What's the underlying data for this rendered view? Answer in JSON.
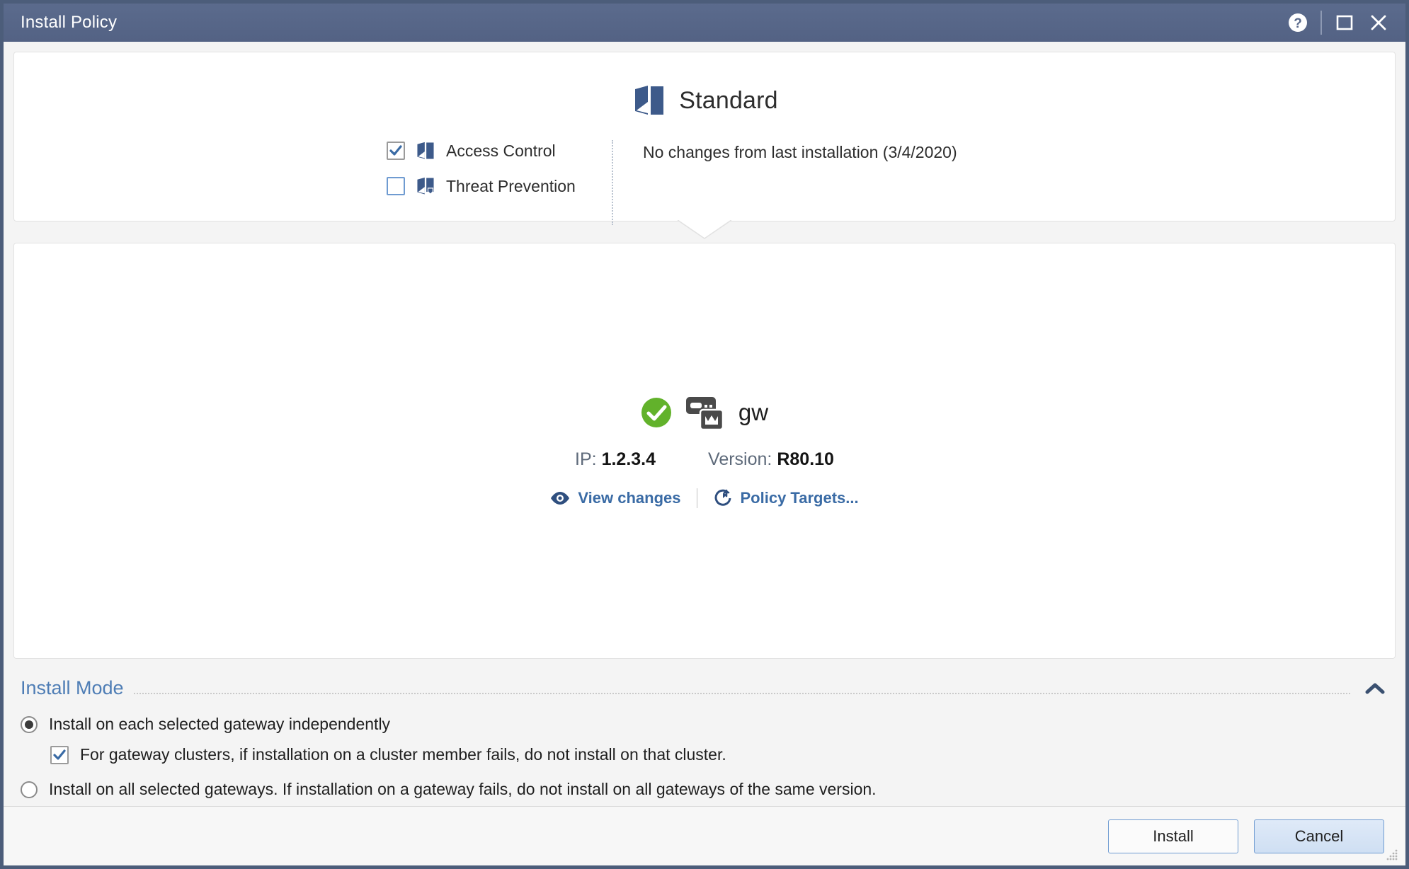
{
  "window": {
    "title": "Install Policy",
    "buttons": {
      "help": "help-icon",
      "maximize": "maximize-icon",
      "close": "close-icon"
    }
  },
  "policy": {
    "icon": "policy-package-icon",
    "name": "Standard",
    "blades": [
      {
        "label": "Access Control",
        "checked": true,
        "icon": "access-control-icon"
      },
      {
        "label": "Threat Prevention",
        "checked": false,
        "icon": "threat-prevention-icon"
      }
    ],
    "changes_note": "No changes from last installation (3/4/2020)"
  },
  "gateway": {
    "status_icon": "status-ok-icon",
    "device_icon": "security-gateway-icon",
    "name": "gw",
    "ip_label": "IP:",
    "ip_value": "1.2.3.4",
    "version_label": "Version:",
    "version_value": "R80.10",
    "links": [
      {
        "label": "View changes",
        "icon": "eye-icon"
      },
      {
        "label": "Policy Targets...",
        "icon": "policy-targets-icon"
      }
    ]
  },
  "install_mode": {
    "title": "Install Mode",
    "collapse_icon": "chevron-up-icon",
    "options": [
      {
        "label": "Install on each selected gateway independently",
        "selected": true,
        "sub": {
          "label": "For gateway clusters, if installation on a cluster member fails, do not install on that cluster.",
          "checked": true
        }
      },
      {
        "label": "Install on all selected gateways. If installation on a gateway fails, do not install on all gateways of the same version.",
        "selected": false
      }
    ]
  },
  "footer": {
    "install_label": "Install",
    "cancel_label": "Cancel"
  },
  "colors": {
    "titlebar": "#57678a",
    "accent_blue": "#3a6ba5",
    "link_blue": "#4e7db5",
    "status_green": "#62b22b",
    "icon_navy": "#3d5a8a"
  }
}
